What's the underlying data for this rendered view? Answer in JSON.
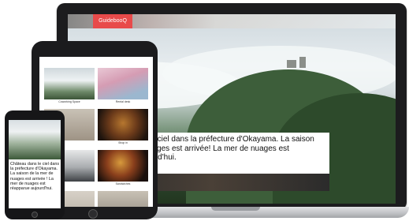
{
  "site": {
    "logo": "GuidebooQ"
  },
  "hero": {
    "caption_desktop": "Château dans le ciel dans la préfecture d'Okayama. La saison de la mer de nuages est arrivée! La mer de nuages est réapparue aujourd'hui.",
    "caption_mobile": "Château dans le ciel dans la préfecture d'Okayama. La saison de la mer de nuages est arrivée ! La mer de nuages est réapparue aujourd'hui."
  },
  "tablet": {
    "tiles": [
      {
        "label": "Coworking Space"
      },
      {
        "label": "Rental desk"
      },
      {
        "label": ""
      },
      {
        "label": "Shop in"
      },
      {
        "label": ""
      },
      {
        "label": "Sandwiches"
      }
    ]
  },
  "colors": {
    "brand": "#e84a4a"
  }
}
